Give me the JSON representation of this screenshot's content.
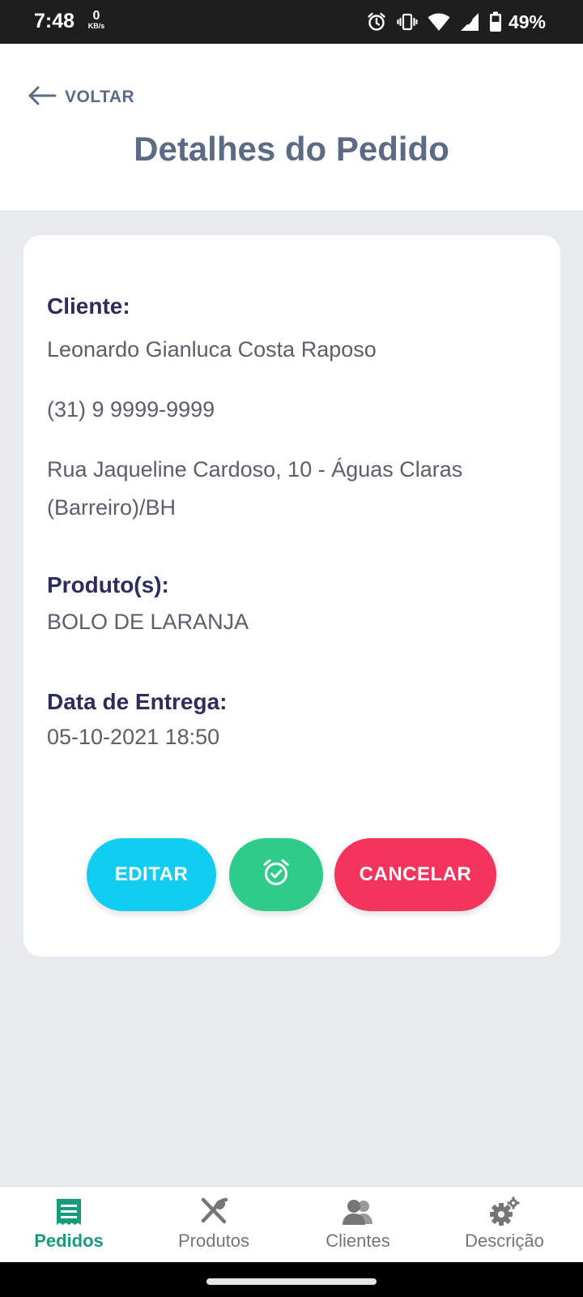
{
  "status_bar": {
    "time": "7:48",
    "speed_value": "0",
    "speed_unit": "KB/s",
    "battery_percent": "49%",
    "icons": [
      "alarm-icon",
      "vibrate-icon",
      "wifi-icon",
      "signal-icon",
      "battery-icon"
    ]
  },
  "header": {
    "back_label": "VOLTAR",
    "title": "Detalhes do Pedido"
  },
  "order": {
    "client_label": "Cliente:",
    "client_name": "Leonardo Gianluca Costa Raposo",
    "client_phone": "(31) 9 9999-9999",
    "client_address": "Rua Jaqueline Cardoso, 10 - Águas Claras (Barreiro)/BH",
    "products_label": "Produto(s):",
    "products": "BOLO DE LARANJA",
    "delivery_label": "Data de Entrega:",
    "delivery_date": "05-10-2021 18:50"
  },
  "actions": {
    "edit_label": "EDITAR",
    "alarm_icon": "alarm-check-icon",
    "cancel_label": "CANCELAR"
  },
  "bottom_nav": {
    "items": [
      {
        "label": "Pedidos",
        "icon": "receipt-icon",
        "active": true
      },
      {
        "label": "Produtos",
        "icon": "utensils-icon",
        "active": false
      },
      {
        "label": "Clientes",
        "icon": "users-icon",
        "active": false
      },
      {
        "label": "Descrição",
        "icon": "gears-icon",
        "active": false
      }
    ]
  },
  "colors": {
    "title": "#5b6b85",
    "label": "#2e2c5a",
    "edit_button": "#12cdf2",
    "alarm_button": "#2ecc8b",
    "cancel_button": "#f5345d",
    "nav_active": "#169c7c",
    "background": "#e7ebee"
  }
}
